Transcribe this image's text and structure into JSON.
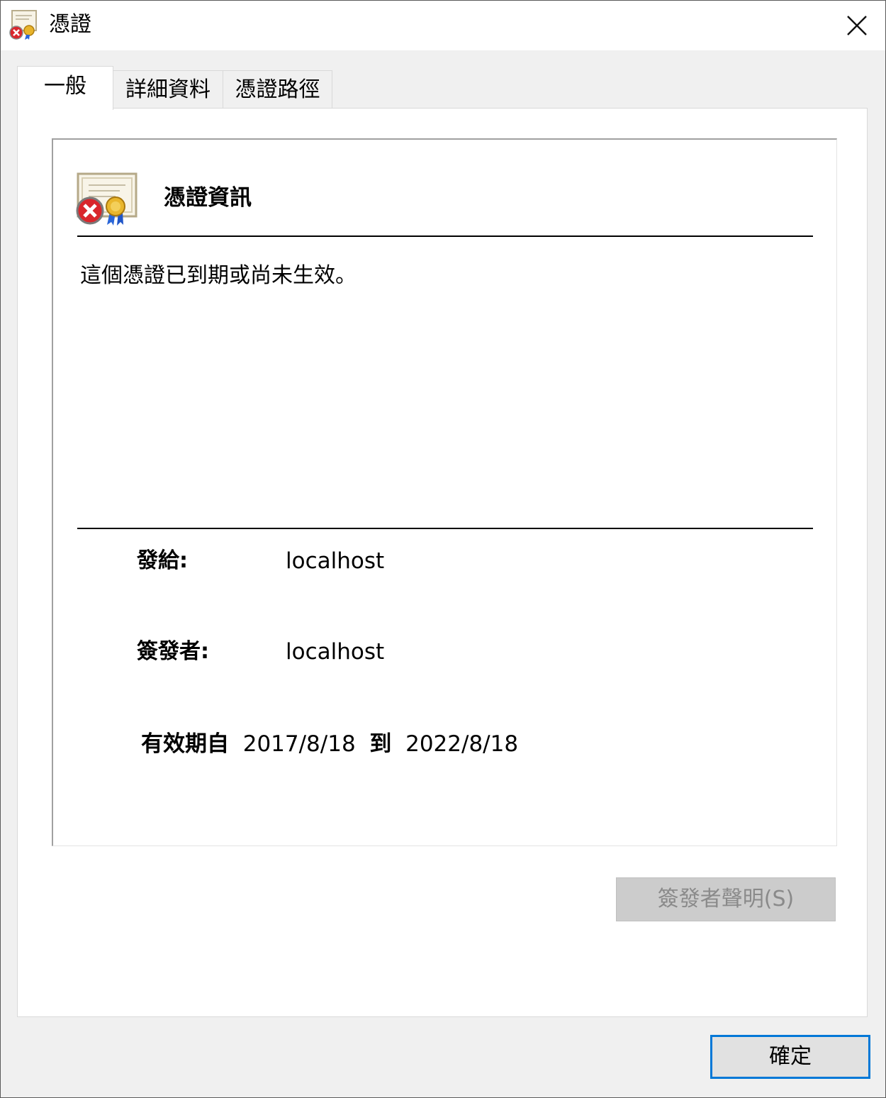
{
  "window": {
    "title": "憑證",
    "close_glyph": "✕"
  },
  "tabs": [
    {
      "label": "一般",
      "active": true
    },
    {
      "label": "詳細資料",
      "active": false
    },
    {
      "label": "憑證路徑",
      "active": false
    }
  ],
  "general": {
    "heading": "憑證資訊",
    "status_message": "這個憑證已到期或尚未生效。",
    "issued_to_label": "發給:",
    "issued_to_value": "localhost",
    "issued_by_label": "簽發者:",
    "issued_by_value": "localhost",
    "validity": {
      "from_label": "有效期自",
      "from_date": "2017/8/18",
      "to_label": "到",
      "to_date": "2022/8/18"
    },
    "issuer_statement_button": "簽發者聲明(S)"
  },
  "footer": {
    "ok_button": "確定"
  },
  "icons": {
    "title": "certificate-error-icon",
    "header": "certificate-error-icon",
    "close": "close-icon"
  },
  "colors": {
    "accent": "#0078d7",
    "error": "#d9262c",
    "disabled_button_bg": "#cccccc"
  }
}
